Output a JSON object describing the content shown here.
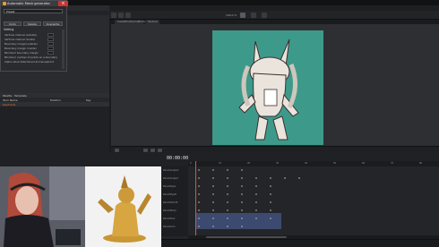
{
  "dialog": {
    "title": "Automatic Mesh generator",
    "close_icon": "×",
    "preset_label": "Preset",
    "buttons": [
      "Undo",
      "Delete",
      "Overwrite"
    ],
    "setting_header": "Setting",
    "settings": [
      "Vertices interval (outside)",
      "Vertices interval (inside)",
      "Boundary margin(outside)",
      "Boundary margin (inside)",
      "Minimum boundary margin",
      "Minimum number of points on a boundary",
      "Alpha value determined as transparent"
    ]
  },
  "app": {
    "title": "Cubism Editor",
    "doc_tabs": [
      "Live2DCubism(Model)",
      "Texture"
    ],
    "zoom": "100.0 %",
    "left_bottom_tabs": [
      "Palette",
      "Template"
    ],
    "left_bottom_columns": [
      "Item Name",
      "Position",
      "Key"
    ],
    "left_bottom_row": "Keyframe"
  },
  "timeline": {
    "timecode": "00:00:00",
    "frame": "0",
    "tracks": [
      "ParamAngleX",
      "ParamAngleY",
      "ParamEyeL",
      "ParamEyeR",
      "ParamMouth",
      "ParamBody",
      "ParamHair",
      "ParamArm"
    ],
    "ruler_ticks": [
      "0",
      "10",
      "20",
      "30",
      "40",
      "50",
      "60",
      "70",
      "80"
    ]
  },
  "colors": {
    "accent": "#d32f2f",
    "artboard": "#3d9a8a",
    "selection": "#3b4a6e"
  }
}
